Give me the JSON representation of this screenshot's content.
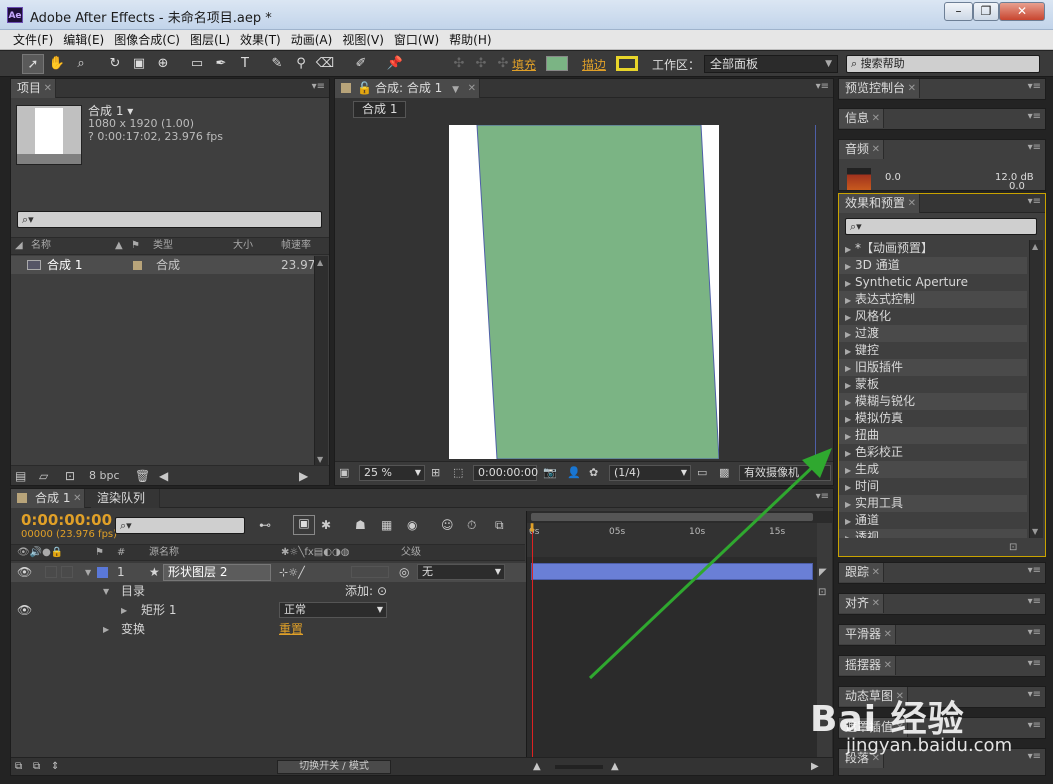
{
  "window": {
    "title": "Adobe After Effects - 未命名项目.aep *",
    "icon_text": "Ae",
    "min": "–",
    "restore": "❐",
    "close": "✕"
  },
  "menu": [
    "文件(F)",
    "编辑(E)",
    "图像合成(C)",
    "图层(L)",
    "效果(T)",
    "动画(A)",
    "视图(V)",
    "窗口(W)",
    "帮助(H)"
  ],
  "toolbar": {
    "fill_label": "填充",
    "stroke_label": "描边",
    "workspace_label": "工作区：",
    "workspace_value": "全部面板",
    "search_placeholder": "搜索帮助",
    "fill_color": "#7bb484",
    "stroke_color": "#e8d52a"
  },
  "project": {
    "tab": "项目",
    "comp_name": "合成 1 ▾",
    "comp_size": "1080 x 1920 (1.00)",
    "comp_duration": "? 0:00:17:02, 23.976 fps",
    "col_name": "名称",
    "col_type": "类型",
    "col_size": "大小",
    "col_fps": "帧速率",
    "item_name": "合成 1",
    "item_type": "合成",
    "item_fps": "23.976",
    "bpc": "8 bpc"
  },
  "composition": {
    "tab": "合成: 合成 1",
    "subtab": "合成 1",
    "zoom": "25 %",
    "timecode": "0:00:00:00",
    "resolution": "(1/4)",
    "camera": "有效摄像机",
    "shape_color": "#7bb484"
  },
  "timeline": {
    "tab": "合成 1",
    "tab2": "渲染队列",
    "timecode": "0:00:00:00",
    "fps": "00000 (23.976 fps)",
    "col_num": "#",
    "col_source": "源名称",
    "col_parent": "父级",
    "layer_num": "1",
    "layer_name": "形状图层 2",
    "parent_value": "无",
    "contents": "目录",
    "add": "添加:",
    "rect": "矩形 1",
    "blend": "正常",
    "transform": "变换",
    "reset": "重置",
    "ruler": [
      "0s",
      "05s",
      "10s",
      "15s"
    ],
    "toggle": "切换开关 / 模式"
  },
  "right_panels": {
    "preview": "预览控制台",
    "info": "信息",
    "audio": "音频",
    "audio_left": "0.0",
    "audio_right": "12.0 dB",
    "audio_right2": "0.0",
    "effects_tab": "效果和预置",
    "effects": [
      "*【动画预置】",
      "3D 通道",
      "Synthetic Aperture",
      "表达式控制",
      "风格化",
      "过渡",
      "键控",
      "旧版插件",
      "蒙板",
      "模糊与锐化",
      "模拟仿真",
      "扭曲",
      "色彩校正",
      "生成",
      "时间",
      "实用工具",
      "通道",
      "透视"
    ],
    "tracker": "跟踪",
    "align": "对齐",
    "smoother": "平滑器",
    "wiggler": "摇摆器",
    "motion_sketch": "动态草图",
    "mask_interp": "遮罩插值",
    "paragraph": "段落"
  },
  "watermark": {
    "brand": "Bai 经验",
    "url": "jingyan.baidu.com"
  }
}
